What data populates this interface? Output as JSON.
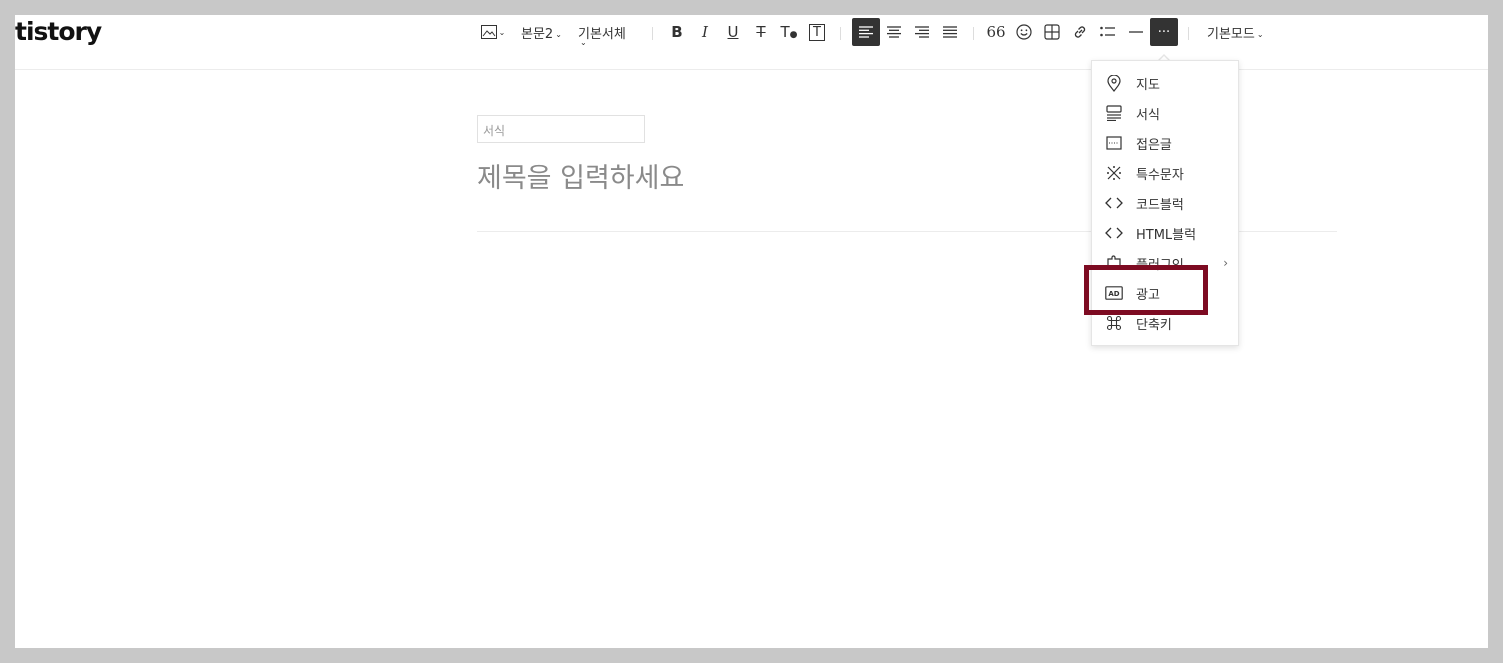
{
  "brand": {
    "logo": "tistory"
  },
  "toolbar": {
    "paragraph_style": "본문2",
    "font_family": "기본서체",
    "bold": "B",
    "italic": "I",
    "underline": "U",
    "strike": "T",
    "text_color": "T",
    "bg_color": "T",
    "quote": "66",
    "more": "···",
    "mode": "기본모드"
  },
  "editor": {
    "category_placeholder": "서식",
    "title_placeholder": "제목을 입력하세요"
  },
  "more_menu": {
    "items": [
      {
        "label": "지도",
        "icon": "map-pin-icon"
      },
      {
        "label": "서식",
        "icon": "template-icon"
      },
      {
        "label": "접은글",
        "icon": "fold-text-icon"
      },
      {
        "label": "특수문자",
        "icon": "special-char-icon"
      },
      {
        "label": "코드블럭",
        "icon": "code-icon"
      },
      {
        "label": "HTML블럭",
        "icon": "html-code-icon"
      },
      {
        "label": "플러그인",
        "icon": "plugin-icon",
        "submenu_arrow": "›"
      },
      {
        "label": "광고",
        "icon": "ad-icon"
      },
      {
        "label": "단축키",
        "icon": "shortcut-icon"
      }
    ]
  },
  "colors": {
    "highlight_border": "#7d0b22",
    "active_button": "#333333"
  }
}
